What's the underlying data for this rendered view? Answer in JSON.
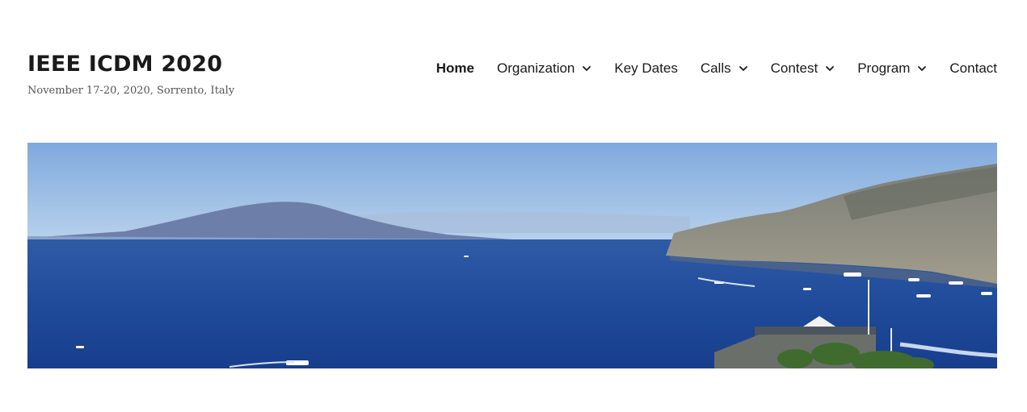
{
  "site": {
    "title": "IEEE ICDM 2020",
    "tagline": "November 17-20, 2020, Sorrento, Italy"
  },
  "nav": {
    "items": [
      {
        "label": "Home",
        "active": true,
        "has_dropdown": false
      },
      {
        "label": "Organization",
        "active": false,
        "has_dropdown": true
      },
      {
        "label": "Key Dates",
        "active": false,
        "has_dropdown": false
      },
      {
        "label": "Calls",
        "active": false,
        "has_dropdown": true
      },
      {
        "label": "Contest",
        "active": false,
        "has_dropdown": true
      },
      {
        "label": "Program",
        "active": false,
        "has_dropdown": true
      },
      {
        "label": "Contact",
        "active": false,
        "has_dropdown": false
      }
    ]
  },
  "hero": {
    "image": "bay-of-naples-panorama",
    "colors": {
      "sky_top": "#7fa9de",
      "sky_horizon": "#b9d2ec",
      "sea_far": "#2f5ba6",
      "sea_near": "#173e8c",
      "volcano": "#6d7fa8",
      "cliff": "#8e8b7e",
      "trees": "#3f6b2f"
    }
  }
}
